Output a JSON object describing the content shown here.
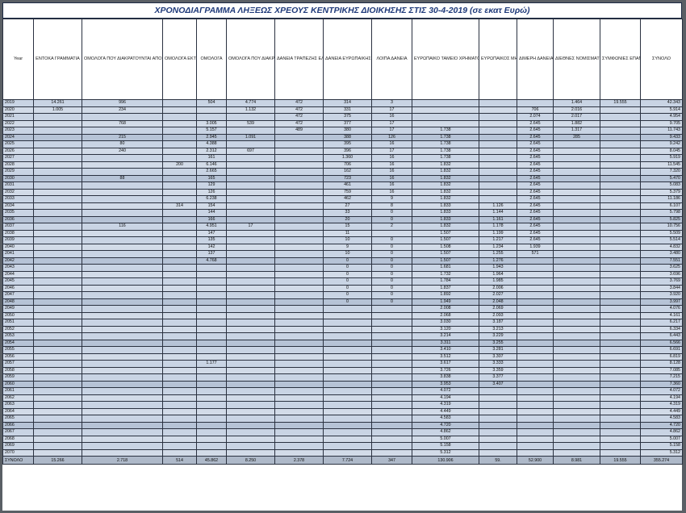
{
  "title": "ΧΡΟΝΟΔΙΑΓΡΑΜΜΑ ΛΗΞΕΩΣ ΧΡΕΟΥΣ  ΚΕΝΤΡΙΚΗΣ ΔΙΟΙΚΗΣΗΣ ΣΤΙΣ 30-4-2019 (σε εκατ Ευρώ)",
  "columns": [
    "Year",
    "ΕΝΤΟΚΑ ΓΡΑΜΜΑΤΙΑ",
    "ΟΜΟΛΟΓΑ ΠΟΥ ΔΙΑΚΡΑΤΟΥΝΤΑΙ ΑΠΟ ΤΙΣ ΕΥΡΩΠΑΙΚΕΣ ΚΕΝΤΡΙΚΕΣ ΤΡΑΠΕΖΕΣ(ΠΡΟΓΡΑΜΜΑ ANFA)",
    "ΟΜΟΛΟΓΑ ΕΚΤΟΣ PSI",
    "ΟΜΟΛΟΓΑ",
    "ΟΜΟΛΟΓΑ ΠΟΥ ΔΙΑΚΡΑΤΟΥΝΤΑΙ ΑΠΟ ΤΗΝ ΕΥΡΩΠΑΙΚΗ ΚΕΝΤΡΙΚΗ ΤΡΑΠΕΖΑ(ΠΡΟΓΡΑΜΜΑ SMP)",
    "ΔΑΝΕΙΑ ΤΡΑΠΕΖΗΣ ΕΛΛΑΔΟΣ",
    "ΔΑΝΕΙΑ ΕΥΡΩΠΑΙΚΗΣ ΤΡΑΠΕΖΑΣ ΕΠΕΝΔΥΣΕΩΝ",
    "ΛΟΙΠΑ ΔΑΝΕΙΑ",
    "ΕΥΡΩΠΑΙΚΟ ΤΑΜΕΙΟ ΧΡΗΜΑΤΟΠΙΣΤΩΤΙΚΗΣ ΣΤΑΘΕΡΟΤΗΤΑΣ(EFSF)",
    "ΕΥΡΩΠΑΙΚΟΣ ΜΗΧΑΝΙΣΜΟΣ ΣΤΑΘΕΡΟΤΗΤΑΣ (ESM)",
    "ΔΙΜΕΡΗ ΔΑΝΕΙΑ ΑΠΟ ΕΥΡΩΠΑΙΚΕΣ ΧΩΡΕΣ(GLF)",
    "ΔΙΕΘΝΕΣ ΝΟΜΙΣΜΑΤΙΚΟ ΤΑΜΕΙΟ (ΔΝΤ)",
    "ΣΥΜΦΩΝΙΕΣ ΕΠΑΝΑΓΟΡΑΣ(REPO)",
    "ΣΥΝΟΛΟ"
  ],
  "rows": [
    [
      "2019",
      "14.261",
      "996",
      "",
      "504",
      "4.774",
      "472",
      "314",
      "3",
      "",
      "",
      "",
      "1.464",
      "19.555",
      "42.343"
    ],
    [
      "2020",
      "1.005",
      "234",
      "",
      "",
      "1.132",
      "472",
      "331",
      "17",
      "",
      "",
      "706",
      "2.016",
      "",
      "5.914"
    ],
    [
      "2021",
      "",
      "",
      "",
      "",
      "",
      "472",
      "375",
      "16",
      "",
      "",
      "2.074",
      "2.017",
      "",
      "4.954"
    ],
    [
      "2022",
      "",
      "768",
      "",
      "3.005",
      "539",
      "472",
      "377",
      "17",
      "",
      "",
      "2.645",
      "1.882",
      "",
      "9.705"
    ],
    [
      "2023",
      "",
      "",
      "",
      "5.157",
      "",
      "489",
      "380",
      "17",
      "1.738",
      "",
      "2.645",
      "1.317",
      "",
      "11.743"
    ],
    [
      "2024",
      "",
      "215",
      "",
      "2.945",
      "1.091",
      "",
      "388",
      "126",
      "1.738",
      "",
      "2.645",
      "285",
      "",
      "9.433"
    ],
    [
      "2025",
      "",
      "80",
      "",
      "4.388",
      "",
      "",
      "395",
      "16",
      "1.738",
      "",
      "2.645",
      "",
      "",
      "9.242"
    ],
    [
      "2026",
      "",
      "240",
      "",
      "2.312",
      "697",
      "",
      "396",
      "17",
      "1.738",
      "",
      "2.645",
      "",
      "",
      "8.045"
    ],
    [
      "2027",
      "",
      "",
      "",
      "161",
      "",
      "",
      "1.360",
      "16",
      "1.738",
      "",
      "2.645",
      "",
      "",
      "5.919"
    ],
    [
      "2028",
      "",
      "",
      "200",
      "6.146",
      "",
      "",
      "706",
      "16",
      "1.832",
      "",
      "2.645",
      "",
      "",
      "11.545"
    ],
    [
      "2029",
      "",
      "",
      "",
      "2.665",
      "",
      "",
      "162",
      "16",
      "1.832",
      "",
      "2.645",
      "",
      "",
      "7.320"
    ],
    [
      "2030",
      "",
      "88",
      "",
      "165",
      "",
      "",
      "723",
      "16",
      "1.832",
      "",
      "2.645",
      "",
      "",
      "5.470"
    ],
    [
      "2031",
      "",
      "",
      "",
      "129",
      "",
      "",
      "461",
      "16",
      "1.832",
      "",
      "2.645",
      "",
      "",
      "5.083"
    ],
    [
      "2032",
      "",
      "",
      "",
      "126",
      "",
      "",
      "759",
      "16",
      "1.832",
      "",
      "2.645",
      "",
      "",
      "5.379"
    ],
    [
      "2033",
      "",
      "",
      "",
      "6.238",
      "",
      "",
      "462",
      "9",
      "1.832",
      "",
      "2.645",
      "",
      "",
      "11.186"
    ],
    [
      "2034",
      "",
      "",
      "314",
      "154",
      "",
      "",
      "27",
      "8",
      "1.833",
      "1.126",
      "2.645",
      "",
      "",
      "6.107"
    ],
    [
      "2035",
      "",
      "",
      "",
      "144",
      "",
      "",
      "33",
      "0",
      "1.833",
      "1.144",
      "2.645",
      "",
      "",
      "5.798"
    ],
    [
      "2036",
      "",
      "",
      "",
      "166",
      "",
      "",
      "20",
      "0",
      "1.833",
      "1.161",
      "2.645",
      "",
      "",
      "5.825"
    ],
    [
      "2037",
      "",
      "116",
      "",
      "4.951",
      "17",
      "",
      "15",
      "2",
      "1.832",
      "1.178",
      "2.645",
      "",
      "",
      "10.756"
    ],
    [
      "2038",
      "",
      "",
      "",
      "147",
      "",
      "",
      "11",
      "",
      "1.507",
      "1.199",
      "2.645",
      "",
      "",
      "5.509"
    ],
    [
      "2039",
      "",
      "",
      "",
      "135",
      "",
      "",
      "10",
      "0",
      "1.507",
      "1.217",
      "2.645",
      "",
      "",
      "5.514"
    ],
    [
      "2040",
      "",
      "",
      "",
      "142",
      "",
      "",
      "9",
      "0",
      "1.508",
      "1.234",
      "1.939",
      "",
      "",
      "4.832"
    ],
    [
      "2041",
      "",
      "",
      "",
      "137",
      "",
      "",
      "10",
      "0",
      "1.507",
      "1.255",
      "571",
      "",
      "",
      "3.480"
    ],
    [
      "2042",
      "",
      "",
      "",
      "4.768",
      "",
      "",
      "0",
      "0",
      "1.507",
      "1.276",
      "",
      "",
      "",
      "7.551"
    ],
    [
      "2043",
      "",
      "",
      "",
      "",
      "",
      "",
      "0",
      "0",
      "1.681",
      "1.943",
      "",
      "",
      "",
      "3.625"
    ],
    [
      "2044",
      "",
      "",
      "",
      "",
      "",
      "",
      "0",
      "0",
      "1.732",
      "1.964",
      "",
      "",
      "",
      "3.696"
    ],
    [
      "2045",
      "",
      "",
      "",
      "",
      "",
      "",
      "0",
      "0",
      "1.784",
      "1.985",
      "",
      "",
      "",
      "3.769"
    ],
    [
      "2046",
      "",
      "",
      "",
      "",
      "",
      "",
      "0",
      "0",
      "1.837",
      "2.006",
      "",
      "",
      "",
      "3.844"
    ],
    [
      "2047",
      "",
      "",
      "",
      "",
      "",
      "",
      "0",
      "0",
      "1.892",
      "2.027",
      "",
      "",
      "",
      "3.920"
    ],
    [
      "2048",
      "",
      "",
      "",
      "",
      "",
      "",
      "0",
      "0",
      "1.949",
      "2.048",
      "",
      "",
      "",
      "3.997"
    ],
    [
      "2049",
      "",
      "",
      "",
      "",
      "",
      "",
      "",
      "",
      "2.008",
      "2.069",
      "",
      "",
      "",
      "4.076"
    ],
    [
      "2050",
      "",
      "",
      "",
      "",
      "",
      "",
      "",
      "",
      "2.068",
      "2.093",
      "",
      "",
      "",
      "4.161"
    ],
    [
      "2051",
      "",
      "",
      "",
      "",
      "",
      "",
      "",
      "",
      "3.030",
      "3.187",
      "",
      "",
      "",
      "6.217"
    ],
    [
      "2052",
      "",
      "",
      "",
      "",
      "",
      "",
      "",
      "",
      "3.120",
      "3.213",
      "",
      "",
      "",
      "6.334"
    ],
    [
      "2053",
      "",
      "",
      "",
      "",
      "",
      "",
      "",
      "",
      "3.214",
      "3.229",
      "",
      "",
      "",
      "6.443"
    ],
    [
      "2054",
      "",
      "",
      "",
      "",
      "",
      "",
      "",
      "",
      "3.311",
      "3.255",
      "",
      "",
      "",
      "6.566"
    ],
    [
      "2055",
      "",
      "",
      "",
      "",
      "",
      "",
      "",
      "",
      "3.410",
      "3.281",
      "",
      "",
      "",
      "6.691"
    ],
    [
      "2056",
      "",
      "",
      "",
      "",
      "",
      "",
      "",
      "",
      "3.512",
      "3.307",
      "",
      "",
      "",
      "6.819"
    ],
    [
      "2057",
      "",
      "",
      "",
      "1.177",
      "",
      "",
      "",
      "",
      "3.617",
      "3.333",
      "",
      "",
      "",
      "8.128"
    ],
    [
      "2058",
      "",
      "",
      "",
      "",
      "",
      "",
      "",
      "",
      "3.726",
      "3.359",
      "",
      "",
      "",
      "7.085"
    ],
    [
      "2059",
      "",
      "",
      "",
      "",
      "",
      "",
      "",
      "",
      "3.838",
      "3.377",
      "",
      "",
      "",
      "7.215"
    ],
    [
      "2060",
      "",
      "",
      "",
      "",
      "",
      "",
      "",
      "",
      "3.953",
      "3.407",
      "",
      "",
      "",
      "7.360"
    ],
    [
      "2061",
      "",
      "",
      "",
      "",
      "",
      "",
      "",
      "",
      "4.072",
      "",
      "",
      "",
      "",
      "4.072"
    ],
    [
      "2062",
      "",
      "",
      "",
      "",
      "",
      "",
      "",
      "",
      "4.194",
      "",
      "",
      "",
      "",
      "4.194"
    ],
    [
      "2063",
      "",
      "",
      "",
      "",
      "",
      "",
      "",
      "",
      "4.319",
      "",
      "",
      "",
      "",
      "4.319"
    ],
    [
      "2064",
      "",
      "",
      "",
      "",
      "",
      "",
      "",
      "",
      "4.449",
      "",
      "",
      "",
      "",
      "4.449"
    ],
    [
      "2065",
      "",
      "",
      "",
      "",
      "",
      "",
      "",
      "",
      "4.583",
      "",
      "",
      "",
      "",
      "4.583"
    ],
    [
      "2066",
      "",
      "",
      "",
      "",
      "",
      "",
      "",
      "",
      "4.720",
      "",
      "",
      "",
      "",
      "4.720"
    ],
    [
      "2067",
      "",
      "",
      "",
      "",
      "",
      "",
      "",
      "",
      "4.862",
      "",
      "",
      "",
      "",
      "4.862"
    ],
    [
      "2068",
      "",
      "",
      "",
      "",
      "",
      "",
      "",
      "",
      "5.007",
      "",
      "",
      "",
      "",
      "5.007"
    ],
    [
      "2069",
      "",
      "",
      "",
      "",
      "",
      "",
      "",
      "",
      "5.158",
      "",
      "",
      "",
      "",
      "5.158"
    ],
    [
      "2070",
      "",
      "",
      "",
      "",
      "",
      "",
      "",
      "",
      "5.312",
      "",
      "",
      "",
      "",
      "5.312"
    ]
  ],
  "totals": [
    "ΣΥΝΟΛΟ",
    "15.266",
    "2.718",
    "514",
    "45.862",
    "8.250",
    "2.378",
    "7.724",
    "347",
    "130.906",
    "59.",
    "52.900",
    "8.981",
    "19.555",
    "355.274"
  ]
}
